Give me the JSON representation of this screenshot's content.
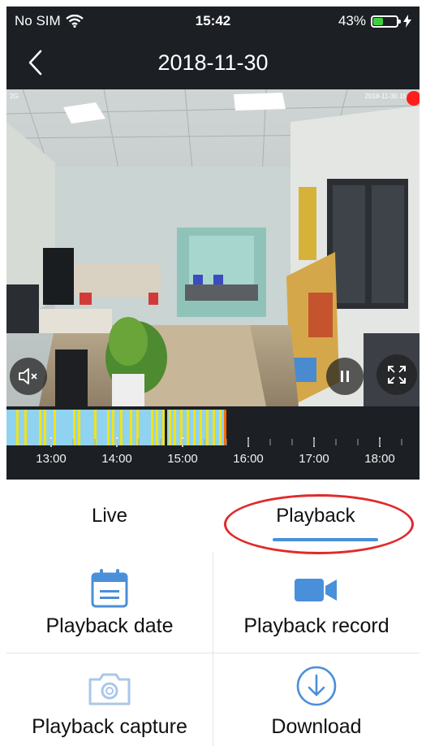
{
  "status": {
    "carrier": "No SIM",
    "time": "15:42",
    "battery": "43%",
    "battery_level": 0.43
  },
  "nav": {
    "title": "2018-11-30",
    "back_icon": "chevron-left-icon"
  },
  "video": {
    "overlay_left": "2G",
    "overlay_timestamp": "2018-11-30 15",
    "mute_icon": "speaker-mute-icon",
    "pause_icon": "pause-icon",
    "fullscreen_icon": "fullscreen-icon"
  },
  "timeline": {
    "labels": [
      "13:00",
      "14:00",
      "15:00",
      "16:00",
      "17:00",
      "18:00"
    ],
    "colors": {
      "recorded": "#8fd3f0",
      "motion": "#f2e21c",
      "cursor": "#ff6a00"
    }
  },
  "tabs": [
    {
      "label": "Live",
      "active": false
    },
    {
      "label": "Playback",
      "active": true
    }
  ],
  "accent": "#4a8fd9",
  "highlight": "#e12a2a",
  "actions": [
    {
      "label": "Playback date",
      "icon": "calendar-icon",
      "enabled": true
    },
    {
      "label": "Playback record",
      "icon": "video-camera-icon",
      "enabled": true
    },
    {
      "label": "Playback capture",
      "icon": "camera-icon",
      "enabled": false
    },
    {
      "label": "Download",
      "icon": "download-icon",
      "enabled": true
    }
  ]
}
